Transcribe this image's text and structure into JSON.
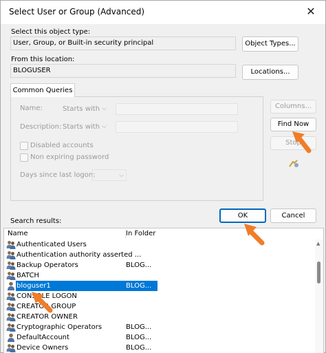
{
  "window": {
    "title": "Select User or Group (Advanced)"
  },
  "object_type": {
    "label": "Select this object type:",
    "value": "User, Group, or Built-in security principal",
    "button": "Object Types..."
  },
  "location": {
    "label": "From this location:",
    "value": "BLOGUSER",
    "button": "Locations..."
  },
  "queries": {
    "tab": "Common Queries",
    "name_label": "Name:",
    "name_mode": "Starts with",
    "description_label": "Description:",
    "description_mode": "Starts with",
    "disabled_accounts": "Disabled accounts",
    "non_expiring_password": "Non expiring password",
    "days_since_logon": "Days since last logon:",
    "columns_button": "Columns...",
    "find_now_button": "Find Now",
    "stop_button": "Stop"
  },
  "actions": {
    "ok": "OK",
    "cancel": "Cancel"
  },
  "results": {
    "label": "Search results:",
    "columns": [
      "Name",
      "In Folder"
    ],
    "rows": [
      {
        "name": "Authenticated Users",
        "folder": "",
        "icon": "group-icon"
      },
      {
        "name": "Authentication authority asserted ...",
        "folder": "",
        "icon": "group-icon"
      },
      {
        "name": "Backup Operators",
        "folder": "BLOG...",
        "icon": "group-icon"
      },
      {
        "name": "BATCH",
        "folder": "",
        "icon": "group-icon"
      },
      {
        "name": "bloguser1",
        "folder": "BLOG...",
        "icon": "user-icon",
        "selected": true
      },
      {
        "name": "CONSOLE LOGON",
        "folder": "",
        "icon": "group-icon"
      },
      {
        "name": "CREATOR GROUP",
        "folder": "",
        "icon": "group-icon"
      },
      {
        "name": "CREATOR OWNER",
        "folder": "",
        "icon": "group-icon"
      },
      {
        "name": "Cryptographic Operators",
        "folder": "BLOG...",
        "icon": "group-icon"
      },
      {
        "name": "DefaultAccount",
        "folder": "BLOG...",
        "icon": "user-icon"
      },
      {
        "name": "Device Owners",
        "folder": "BLOG...",
        "icon": "group-icon"
      }
    ]
  },
  "colors": {
    "accent": "#0067c0",
    "selection": "#0078d7",
    "annotation_arrow": "#f07d28"
  }
}
